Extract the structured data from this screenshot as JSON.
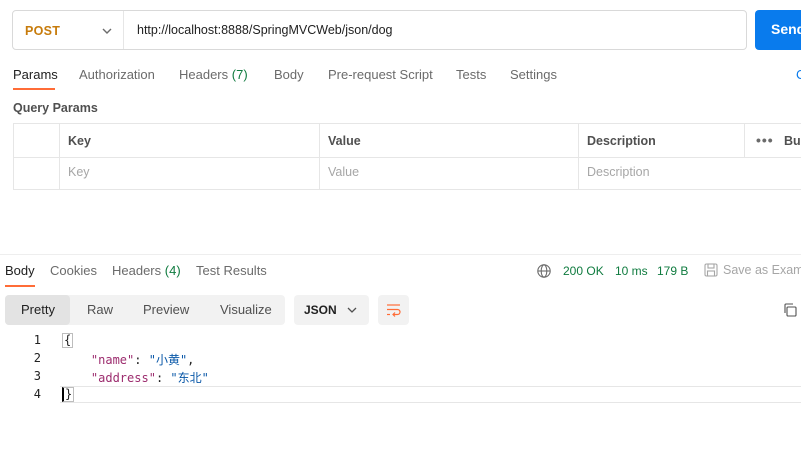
{
  "request": {
    "method": "POST",
    "url": "http://localhost:8888/SpringMVCWeb/json/dog",
    "send_label": "Send"
  },
  "request_tabs": [
    {
      "label": "Params",
      "count": ""
    },
    {
      "label": "Authorization",
      "count": ""
    },
    {
      "label": "Headers",
      "count": "(7)"
    },
    {
      "label": "Body",
      "count": ""
    },
    {
      "label": "Pre-request Script",
      "count": ""
    },
    {
      "label": "Tests",
      "count": ""
    },
    {
      "label": "Settings",
      "count": ""
    }
  ],
  "cookies_link": "C",
  "query_params": {
    "title": "Query Params",
    "headers": [
      "Key",
      "Value",
      "Description"
    ],
    "bulk_edit": "Bu",
    "placeholders": [
      "Key",
      "Value",
      "Description"
    ]
  },
  "response": {
    "tabs": [
      {
        "label": "Body",
        "count": ""
      },
      {
        "label": "Cookies",
        "count": ""
      },
      {
        "label": "Headers",
        "count": "(4)"
      },
      {
        "label": "Test Results",
        "count": ""
      }
    ],
    "status": "200 OK",
    "time": "10 ms",
    "size": "179 B",
    "save_label": "Save as Exam",
    "view_modes": [
      "Pretty",
      "Raw",
      "Preview",
      "Visualize"
    ],
    "format": "JSON",
    "code": {
      "line_numbers": [
        "1",
        "2",
        "3",
        "4"
      ],
      "open_brace": "{",
      "close_brace": "}",
      "pairs": [
        {
          "key": "\"name\"",
          "value": "\"小黄\"",
          "trail": ","
        },
        {
          "key": "\"address\"",
          "value": "\"东北\"",
          "trail": ""
        }
      ]
    }
  },
  "colors": {
    "accent": "#ff6c37",
    "send": "#097bed",
    "method": "#c77b0b",
    "status": "#0f7b3f"
  }
}
